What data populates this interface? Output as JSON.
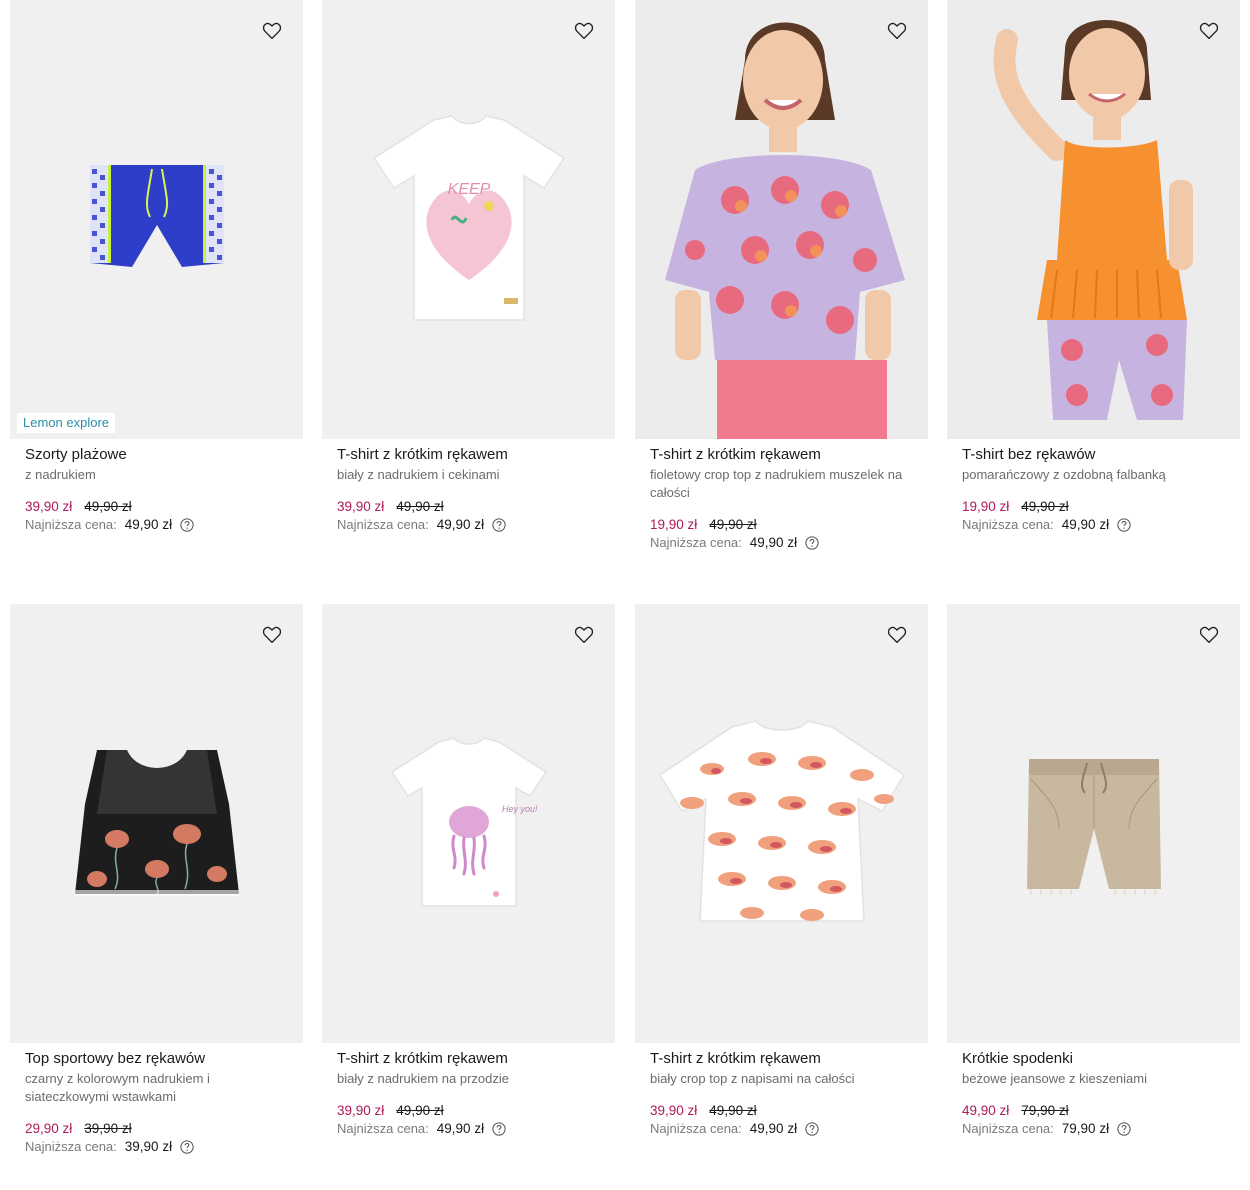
{
  "products": [
    {
      "title": "Szorty plażowe",
      "desc": "z nadrukiem",
      "price": "39,90 zł",
      "old_price": "49,90 zł",
      "lowest_label": "Najniższa cena:",
      "lowest_price": "49,90 zł",
      "badge": "Lemon explore",
      "image": "blue-swim-shorts"
    },
    {
      "title": "T-shirt z krótkim rękawem",
      "desc": "biały z nadrukiem i cekinami",
      "price": "39,90 zł",
      "old_price": "49,90 zł",
      "lowest_label": "Najniższa cena:",
      "lowest_price": "49,90 zł",
      "image": "white-tshirt-heart-print"
    },
    {
      "title": "T-shirt z krótkim rękawem",
      "desc": "fioletowy crop top z nadrukiem muszelek na całości",
      "price": "19,90 zł",
      "old_price": "49,90 zł",
      "lowest_label": "Najniższa cena:",
      "lowest_price": "49,90 zł",
      "image": "girl-lilac-shell-top"
    },
    {
      "title": "T-shirt bez rękawów",
      "desc": "pomarańczowy z ozdobną falbanką",
      "price": "19,90 zł",
      "old_price": "49,90 zł",
      "lowest_label": "Najniższa cena:",
      "lowest_price": "49,90 zł",
      "image": "girl-orange-tank-top"
    },
    {
      "title": "Top sportowy bez rękawów",
      "desc": "czarny z kolorowym nadrukiem i siateczkowymi wstawkami",
      "price": "29,90 zł",
      "old_price": "39,90 zł",
      "lowest_label": "Najniższa cena:",
      "lowest_price": "39,90 zł",
      "image": "black-jellyfish-crop-top"
    },
    {
      "title": "T-shirt z krótkim rękawem",
      "desc": "biały z nadrukiem na przodzie",
      "price": "39,90 zł",
      "old_price": "49,90 zł",
      "lowest_label": "Najniższa cena:",
      "lowest_price": "49,90 zł",
      "image": "white-tshirt-jellyfish"
    },
    {
      "title": "T-shirt z krótkim rękawem",
      "desc": "biały crop top z napisami na całości",
      "price": "39,90 zł",
      "old_price": "49,90 zł",
      "lowest_label": "Najniższa cena:",
      "lowest_price": "49,90 zł",
      "image": "white-crop-top-ocean-print"
    },
    {
      "title": "Krótkie spodenki",
      "desc": "beżowe jeansowe z kieszeniami",
      "price": "49,90 zł",
      "old_price": "79,90 zł",
      "lowest_label": "Najniższa cena:",
      "lowest_price": "79,90 zł",
      "image": "beige-denim-shorts"
    }
  ],
  "icons": {
    "favorite": "heart-outline-icon",
    "help": "question-circle-icon"
  },
  "colors": {
    "sale_price": "#b0195a",
    "badge_text": "#2a8fa8",
    "card_bg": "#f0f0f0"
  }
}
